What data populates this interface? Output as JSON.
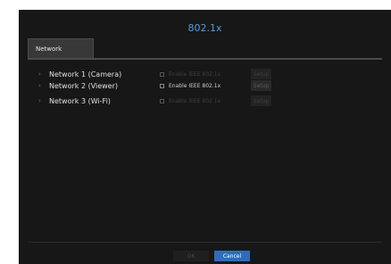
{
  "dialog": {
    "title": "802.1x"
  },
  "tabs": [
    {
      "label": "Network"
    }
  ],
  "networks": [
    {
      "label": "Network 1 (Camera)",
      "enable_label": "Enable IEEE 802.1x",
      "setup_label": "Setup",
      "active": false
    },
    {
      "label": "Network 2 (Viewer)",
      "enable_label": "Enable IEEE 802.1x",
      "setup_label": "Setup",
      "active": true
    },
    {
      "label": "Network 3 (Wi-Fi)",
      "enable_label": "Enable IEEE 802.1x",
      "setup_label": "Setup",
      "active": false
    }
  ],
  "footer": {
    "ok_label": "OK",
    "cancel_label": "Cancel"
  },
  "colors": {
    "accent": "#5b9bd5",
    "cancel_button": "#2f6db8",
    "background": "#171717"
  }
}
